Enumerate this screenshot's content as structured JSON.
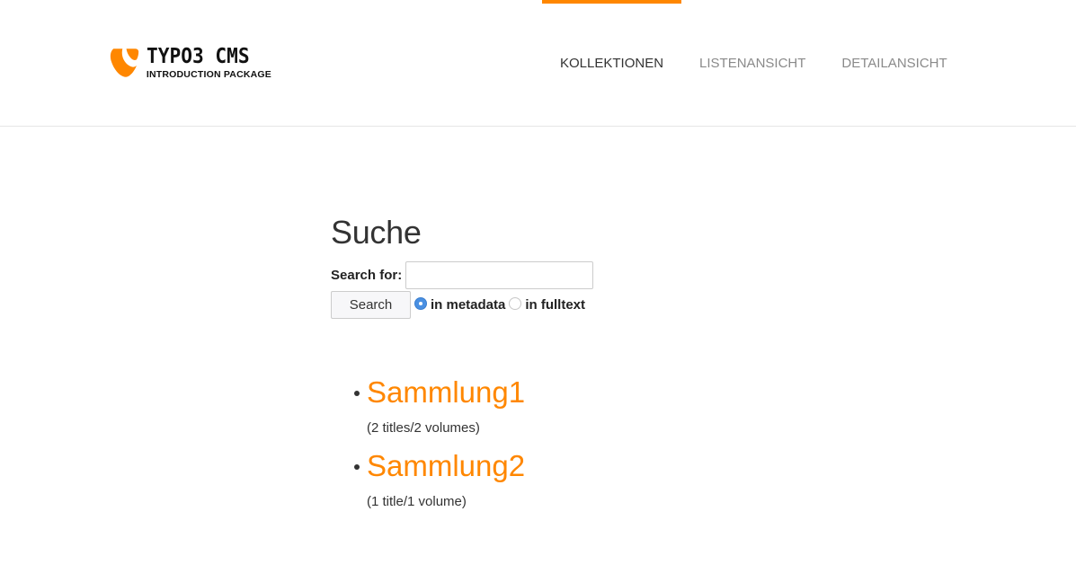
{
  "header": {
    "logo": {
      "title": "TYPO3 CMS",
      "subtitle": "INTRODUCTION PACKAGE",
      "brand_color": "#ff8700"
    },
    "nav": [
      {
        "label": "KOLLEKTIONEN",
        "active": true
      },
      {
        "label": "LISTENANSICHT",
        "active": false
      },
      {
        "label": "DETAILANSICHT",
        "active": false
      }
    ]
  },
  "main": {
    "title": "Suche",
    "search": {
      "label": "Search for:",
      "value": "",
      "placeholder": "",
      "button_label": "Search",
      "options": [
        {
          "label": "in metadata",
          "checked": true
        },
        {
          "label": "in fulltext",
          "checked": false
        }
      ]
    },
    "collections": [
      {
        "name": "Sammlung1",
        "meta": "(2 titles/2 volumes)"
      },
      {
        "name": "Sammlung2",
        "meta": "(1 title/1 volume)"
      }
    ]
  },
  "colors": {
    "accent": "#ff8700",
    "radio_checked": "#4a90e2",
    "text": "#333333",
    "nav_inactive": "#8a8a8a"
  }
}
